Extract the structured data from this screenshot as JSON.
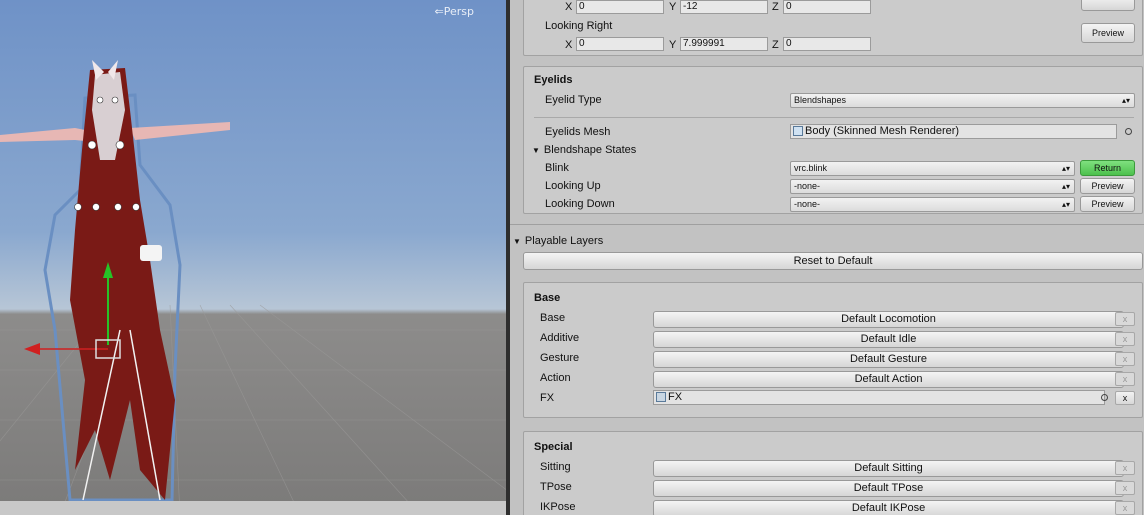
{
  "scene": {
    "view_label": "Persp",
    "view_icon": "back-arrows-icon"
  },
  "look_fields": {
    "row1": {
      "x_label": "X",
      "x": "0",
      "y_label": "Y",
      "y": "-12",
      "z_label": "Z",
      "z": "0"
    },
    "looking_right_label": "Looking Right",
    "row2": {
      "x_label": "X",
      "x": "0",
      "y_label": "Y",
      "y": "7.999991",
      "z_label": "Z",
      "z": "0"
    },
    "preview_label": "Preview"
  },
  "eyelids": {
    "title": "Eyelids",
    "type_label": "Eyelid Type",
    "type_value": "Blendshapes",
    "mesh_label": "Eyelids Mesh",
    "mesh_value": "Body (Skinned Mesh Renderer)",
    "states_label": "Blendshape States",
    "rows": [
      {
        "label": "Blink",
        "value": "vrc.blink",
        "button": "Return"
      },
      {
        "label": "Looking Up",
        "value": "-none-",
        "button": "Preview"
      },
      {
        "label": "Looking Down",
        "value": "-none-",
        "button": "Preview"
      }
    ]
  },
  "playable_layers": {
    "title": "Playable Layers",
    "reset_label": "Reset to Default"
  },
  "base": {
    "title": "Base",
    "rows": [
      {
        "label": "Base",
        "value": "Default Locomotion",
        "x": "x"
      },
      {
        "label": "Additive",
        "value": "Default Idle",
        "x": "x"
      },
      {
        "label": "Gesture",
        "value": "Default Gesture",
        "x": "x"
      },
      {
        "label": "Action",
        "value": "Default Action",
        "x": "x"
      }
    ],
    "fx": {
      "label": "FX",
      "value": "FX",
      "x": "x"
    }
  },
  "special": {
    "title": "Special",
    "rows": [
      {
        "label": "Sitting",
        "value": "Default Sitting",
        "x": "x"
      },
      {
        "label": "TPose",
        "value": "Default TPose",
        "x": "x"
      },
      {
        "label": "IKPose",
        "value": "Default IKPose",
        "x": "x"
      }
    ]
  },
  "colors": {
    "return_button": "#5ccf5c",
    "scene_sky": "#7a9bcc",
    "inspector_bg": "#c2c2c2"
  }
}
